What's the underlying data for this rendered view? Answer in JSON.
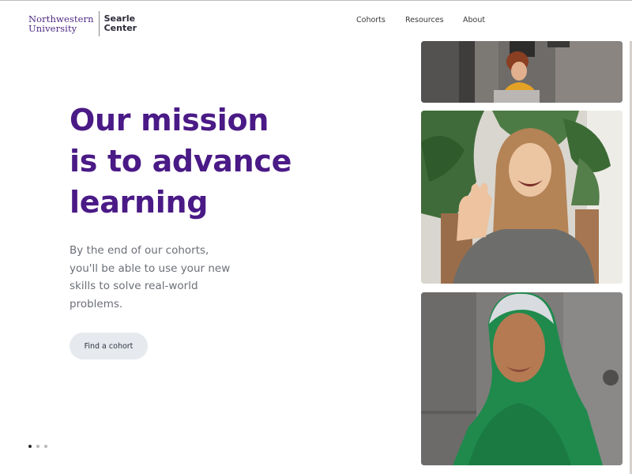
{
  "header": {
    "logo": {
      "university_line1": "Northwestern",
      "university_line2": "University",
      "center_line1": "Searle",
      "center_line2": "Center"
    },
    "nav": [
      "Cohorts",
      "Resources",
      "About"
    ]
  },
  "hero": {
    "title_lines": [
      "Our mission",
      "is to advance",
      "learning"
    ],
    "subtitle_lines": [
      "By the end of our cohorts,",
      "you'll be able to use your new",
      "skills to solve real-world",
      "problems."
    ],
    "cta_label": "Find a cohort"
  },
  "carousel": {
    "dot_count": 3,
    "active_index": 0
  },
  "photos": [
    {
      "name": "woman-at-laptop-photo"
    },
    {
      "name": "woman-waving-photo"
    },
    {
      "name": "woman-green-hijab-photo"
    }
  ],
  "colors": {
    "brand_purple": "#4a1a86",
    "logo_purple": "#4e2a84",
    "button_bg": "#e6e9ee",
    "subtitle_gray": "#6b6f77"
  }
}
